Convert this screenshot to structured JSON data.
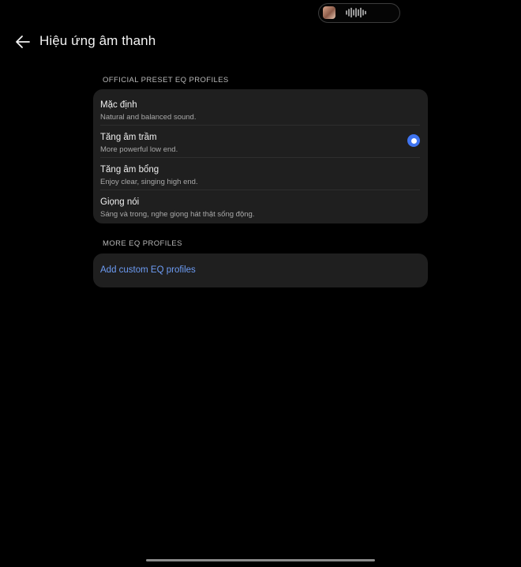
{
  "status": {
    "media_pill": {
      "thumbnail_icon": "album-art-thumbnail",
      "waveform_icon": "audio-waveform-icon"
    }
  },
  "header": {
    "back_icon": "arrow-left-icon",
    "title": "Hiệu ứng âm thanh"
  },
  "official_section": {
    "label": "OFFICIAL PRESET EQ PROFILES",
    "items": [
      {
        "title": "Mặc định",
        "subtitle": "Natural and balanced sound.",
        "selected": false
      },
      {
        "title": "Tăng âm trầm",
        "subtitle": "More powerful low end.",
        "selected": true
      },
      {
        "title": "Tăng âm bổng",
        "subtitle": "Enjoy clear, singing high end.",
        "selected": false
      },
      {
        "title": "Giọng nói",
        "subtitle": "Sáng và trong, nghe giọng hát thật sống động.",
        "selected": false
      }
    ]
  },
  "more_section": {
    "label": "MORE EQ PROFILES",
    "add_link": "Add custom EQ profiles"
  },
  "colors": {
    "background": "#000000",
    "card": "#1f1f1f",
    "accent": "#3f74f0",
    "link": "#6d9cf4"
  }
}
